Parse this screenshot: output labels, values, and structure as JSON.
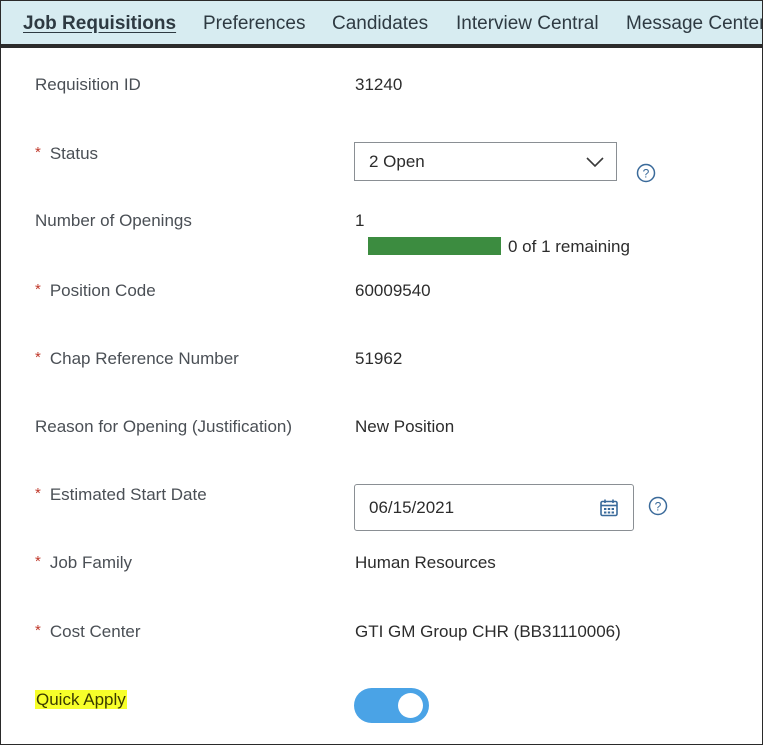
{
  "tabs": [
    {
      "label": "Job Requisitions",
      "active": true
    },
    {
      "label": "Preferences",
      "active": false
    },
    {
      "label": "Candidates",
      "active": false
    },
    {
      "label": "Interview Central",
      "active": false
    },
    {
      "label": "Message Center",
      "active": false
    }
  ],
  "required_marker": "*",
  "fields": {
    "requisition_id": {
      "label": "Requisition ID",
      "value": "31240"
    },
    "status": {
      "label": "Status",
      "value": "2 Open",
      "required": true
    },
    "openings": {
      "label": "Number of Openings",
      "value": "1",
      "remaining_text": "0 of 1 remaining",
      "progress_fraction": 1.0
    },
    "position_code": {
      "label": "Position Code",
      "value": "60009540",
      "required": true
    },
    "chap_reference": {
      "label": "Chap Reference Number",
      "value": "51962",
      "required": true
    },
    "reason": {
      "label": "Reason for Opening (Justification)",
      "value": "New Position"
    },
    "start_date": {
      "label": "Estimated Start Date",
      "value": "06/15/2021",
      "required": true
    },
    "job_family": {
      "label": "Job Family",
      "value": "Human Resources",
      "required": true
    },
    "cost_center": {
      "label": "Cost Center",
      "value": "GTI GM Group CHR (BB31110006)",
      "required": true
    },
    "quick_apply": {
      "label": "Quick Apply",
      "enabled": true
    }
  },
  "colors": {
    "tab_bar_bg": "#d7ecf1",
    "required": "#c0392b",
    "progress_fill": "#3c8c40",
    "toggle_on": "#4aa3e6",
    "highlight": "#f7ff2a"
  },
  "icons": {
    "status_help": "help-circle-icon",
    "date_help": "help-circle-icon",
    "calendar": "calendar-icon",
    "dropdown": "chevron-down-icon"
  }
}
